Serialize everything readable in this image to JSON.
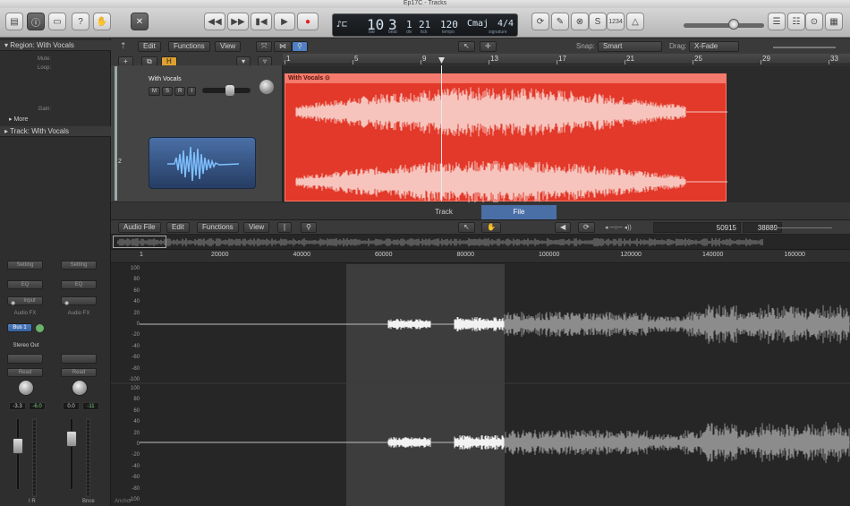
{
  "window": {
    "title": "Ep17C - Tracks"
  },
  "toolbar": {
    "transport": {
      "rewind_icon": "rewind-icon",
      "fast_forward_icon": "fast-forward-icon",
      "go_to_start_icon": "go-to-start-icon",
      "play_icon": "play-icon",
      "record_icon": "record-icon"
    },
    "lcd": {
      "bar": "10",
      "beat": "3",
      "div": "1",
      "tick": "21",
      "tempo": "120",
      "key": "Cmaj",
      "signature": "4/4",
      "bar_label": "bar",
      "beat_label": "beat",
      "div_label": "div",
      "tick_label": "tick",
      "tempo_label": "tempo",
      "signature_label": "signature"
    },
    "count_in": "1234"
  },
  "inspector": {
    "region_header": "Region: With Vocals",
    "mute_label": "Mute:",
    "loop_label": "Loop:",
    "gain_label": "Gain:",
    "more_label": "More",
    "track_header": "Track: With Vocals",
    "strips": [
      {
        "setting": "Setting",
        "eq": "EQ",
        "input": "Input",
        "audio_fx": "Audio FX",
        "send": "Bus 1",
        "output": "Stereo Out",
        "automation": "Read",
        "pan_value": "-3.3",
        "peak_value": "-6.0",
        "name": "I R"
      },
      {
        "setting": "Setting",
        "eq": "EQ",
        "input": "",
        "audio_fx": "Audio FX",
        "send": "",
        "output": "",
        "automation": "Read",
        "pan_value": "0.0",
        "peak_value": "-11",
        "name": "Bnce"
      }
    ]
  },
  "tracks": {
    "menus": {
      "edit": "Edit",
      "functions": "Functions",
      "view": "View"
    },
    "snap_label": "Snap:",
    "snap_value": "Smart",
    "drag_label": "Drag:",
    "drag_value": "X-Fade",
    "add_button": "+",
    "h_button": "H",
    "ruler_bars": [
      "1",
      "5",
      "9",
      "13",
      "17",
      "21",
      "25",
      "29",
      "33"
    ],
    "track": {
      "number": "2",
      "name": "With Vocals",
      "buttons": [
        "M",
        "S",
        "R",
        "I"
      ]
    },
    "region": {
      "name": "With Vocals"
    }
  },
  "editor": {
    "tabs": [
      "Track",
      "File"
    ],
    "active_tab": "File",
    "menus": {
      "audio_file": "Audio File",
      "edit": "Edit",
      "functions": "Functions",
      "view": "View"
    },
    "start_value": "50915",
    "length_value": "38889",
    "sample_scale": [
      "1",
      "20000",
      "40000",
      "60000",
      "80000",
      "100000",
      "120000",
      "140000",
      "160000"
    ],
    "y_ticks": [
      "100",
      "80",
      "60",
      "40",
      "20",
      "0",
      "-20",
      "-40",
      "-60",
      "-80",
      "-100"
    ],
    "anchor_label": "Anchor"
  }
}
